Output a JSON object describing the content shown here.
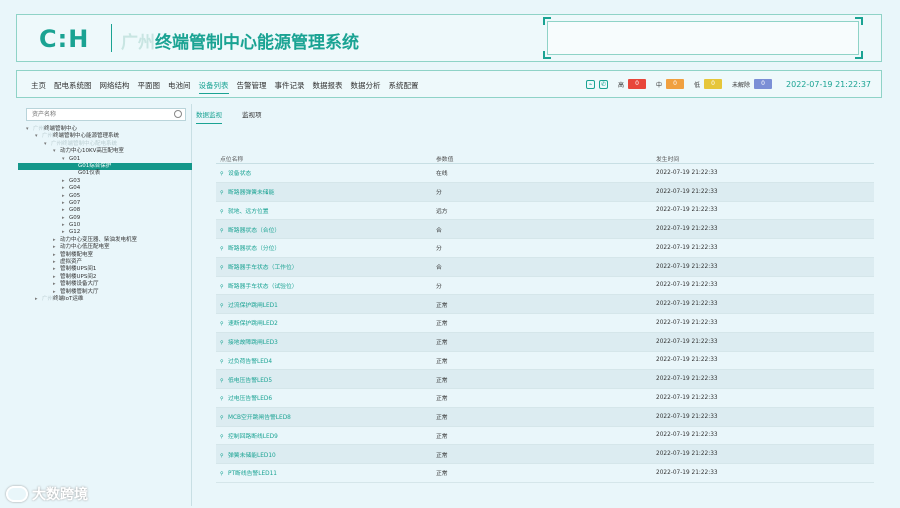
{
  "header": {
    "logo": "C:H",
    "title_prefix": "广州",
    "title": "终端管制中心能源管理系统"
  },
  "nav": {
    "items": [
      "主页",
      "配电系统图",
      "网络结构",
      "平面图",
      "电池间",
      "设备列表",
      "告警管理",
      "事件记录",
      "数据报表",
      "数据分析",
      "系统配置"
    ],
    "active_index": 5
  },
  "status": {
    "icons": [
      "link-icon",
      "phone-icon"
    ],
    "levels": [
      {
        "label": "高",
        "count": "0",
        "color": "#e8463a"
      },
      {
        "label": "中",
        "count": "0",
        "color": "#f0a040"
      },
      {
        "label": "低",
        "count": "0",
        "color": "#e6c63a"
      },
      {
        "label": "未解除",
        "count": "0",
        "color": "#7b8fd6"
      }
    ],
    "datetime": "2022-07-19 21:22:37"
  },
  "sidebar": {
    "search_placeholder": "资产名称",
    "tree": [
      {
        "label": "终端管制中心",
        "indent": 0,
        "arrow": "▾",
        "prefix": "广州"
      },
      {
        "label": "终端管制中心能源管理系统",
        "indent": 1,
        "arrow": "▾",
        "prefix": "广州"
      },
      {
        "label": "",
        "indent": 2,
        "arrow": "▾",
        "prefix": "广州终端管制中心配电系统"
      },
      {
        "label": "动力中心10KV高压配电室",
        "indent": 3,
        "arrow": "▾"
      },
      {
        "label": "G01",
        "indent": 4,
        "arrow": "▾"
      },
      {
        "label": "G01综合保护",
        "indent": 5,
        "arrow": "",
        "selected": true
      },
      {
        "label": "G01仪表",
        "indent": 5,
        "arrow": ""
      },
      {
        "label": "G03",
        "indent": 4,
        "arrow": "▸"
      },
      {
        "label": "G04",
        "indent": 4,
        "arrow": "▸"
      },
      {
        "label": "G05",
        "indent": 4,
        "arrow": "▸"
      },
      {
        "label": "G07",
        "indent": 4,
        "arrow": "▸"
      },
      {
        "label": "G08",
        "indent": 4,
        "arrow": "▸"
      },
      {
        "label": "G09",
        "indent": 4,
        "arrow": "▸"
      },
      {
        "label": "G10",
        "indent": 4,
        "arrow": "▸"
      },
      {
        "label": "G12",
        "indent": 4,
        "arrow": "▸"
      },
      {
        "label": "动力中心变压器、柴油发电机室",
        "indent": 3,
        "arrow": "▸"
      },
      {
        "label": "动力中心低压配电室",
        "indent": 3,
        "arrow": "▸"
      },
      {
        "label": "管制楼配电室",
        "indent": 3,
        "arrow": "▸"
      },
      {
        "label": "虚拟资产",
        "indent": 3,
        "arrow": "▸"
      },
      {
        "label": "管制楼UPS间1",
        "indent": 3,
        "arrow": "▸"
      },
      {
        "label": "管制楼UPS间2",
        "indent": 3,
        "arrow": "▸"
      },
      {
        "label": "管制楼设备大厅",
        "indent": 3,
        "arrow": "▸"
      },
      {
        "label": "管制楼管制大厅",
        "indent": 3,
        "arrow": "▸"
      },
      {
        "label": "终端IoT运维",
        "indent": 1,
        "arrow": "▸",
        "prefix": "广州"
      }
    ]
  },
  "main": {
    "tabs": [
      "数据监视",
      "监视项"
    ],
    "active_tab": 0,
    "columns": [
      "点位名称",
      "参数值",
      "发生时间"
    ],
    "rows": [
      [
        "设备状态",
        "在线",
        "2022-07-19 21:22:33"
      ],
      [
        "断路器弹簧未储能",
        "分",
        "2022-07-19 21:22:33"
      ],
      [
        "就地、远方位置",
        "远方",
        "2022-07-19 21:22:33"
      ],
      [
        "断路器状态（合位）",
        "合",
        "2022-07-19 21:22:33"
      ],
      [
        "断路器状态（分位）",
        "分",
        "2022-07-19 21:22:33"
      ],
      [
        "断路器手车状态（工作位）",
        "合",
        "2022-07-19 21:22:33"
      ],
      [
        "断路器手车状态（试验位）",
        "分",
        "2022-07-19 21:22:33"
      ],
      [
        "过流保护跳闸LED1",
        "正常",
        "2022-07-19 21:22:33"
      ],
      [
        "速断保护跳闸LED2",
        "正常",
        "2022-07-19 21:22:33"
      ],
      [
        "接地故障跳闸LED3",
        "正常",
        "2022-07-19 21:22:33"
      ],
      [
        "过负荷告警LED4",
        "正常",
        "2022-07-19 21:22:33"
      ],
      [
        "低电压告警LED5",
        "正常",
        "2022-07-19 21:22:33"
      ],
      [
        "过电压告警LED6",
        "正常",
        "2022-07-19 21:22:33"
      ],
      [
        "MCB空开跳闸告警LED8",
        "正常",
        "2022-07-19 21:22:33"
      ],
      [
        "控制回路断线LED9",
        "正常",
        "2022-07-19 21:22:33"
      ],
      [
        "弹簧未储能LED10",
        "正常",
        "2022-07-19 21:22:33"
      ],
      [
        "PT断线告警LED11",
        "正常",
        "2022-07-19 21:22:33"
      ]
    ]
  },
  "watermark": {
    "text": "大数跨境"
  }
}
